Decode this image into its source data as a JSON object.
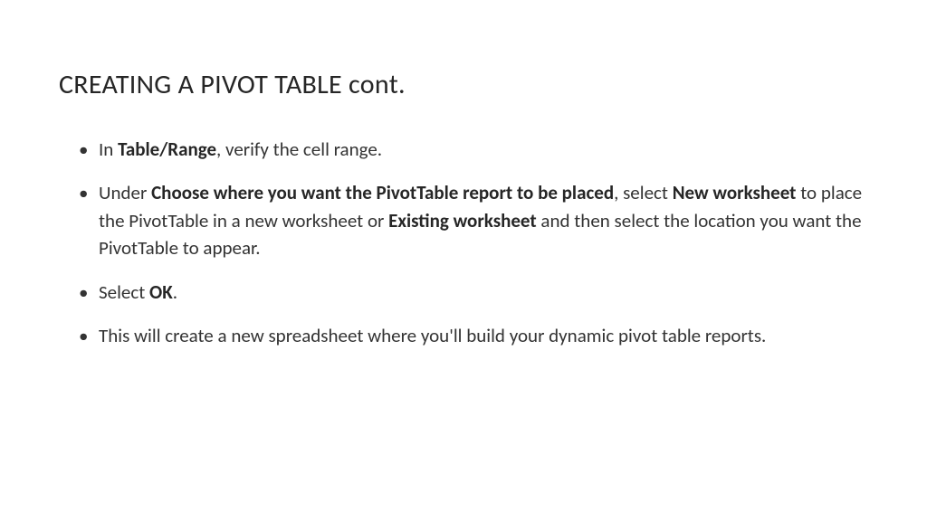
{
  "slide": {
    "title": "CREATING A PIVOT TABLE cont.",
    "bullets": [
      {
        "segments": [
          {
            "text": "In ",
            "bold": false
          },
          {
            "text": "Table/Range",
            "bold": true
          },
          {
            "text": ", verify the cell range.",
            "bold": false
          }
        ]
      },
      {
        "segments": [
          {
            "text": "Under ",
            "bold": false
          },
          {
            "text": "Choose where you want the PivotTable report to be placed",
            "bold": true
          },
          {
            "text": ", select ",
            "bold": false
          },
          {
            "text": "New worksheet",
            "bold": true
          },
          {
            "text": " to place the PivotTable in a new worksheet or ",
            "bold": false
          },
          {
            "text": "Existing worksheet",
            "bold": true
          },
          {
            "text": " and then select the location you want the PivotTable to appear.",
            "bold": false
          }
        ]
      },
      {
        "segments": [
          {
            "text": "Select ",
            "bold": false
          },
          {
            "text": "OK",
            "bold": true
          },
          {
            "text": ".",
            "bold": false
          }
        ]
      },
      {
        "segments": [
          {
            "text": "This will create a new spreadsheet where you'll build your dynamic pivot table reports.",
            "bold": false
          }
        ]
      }
    ]
  }
}
